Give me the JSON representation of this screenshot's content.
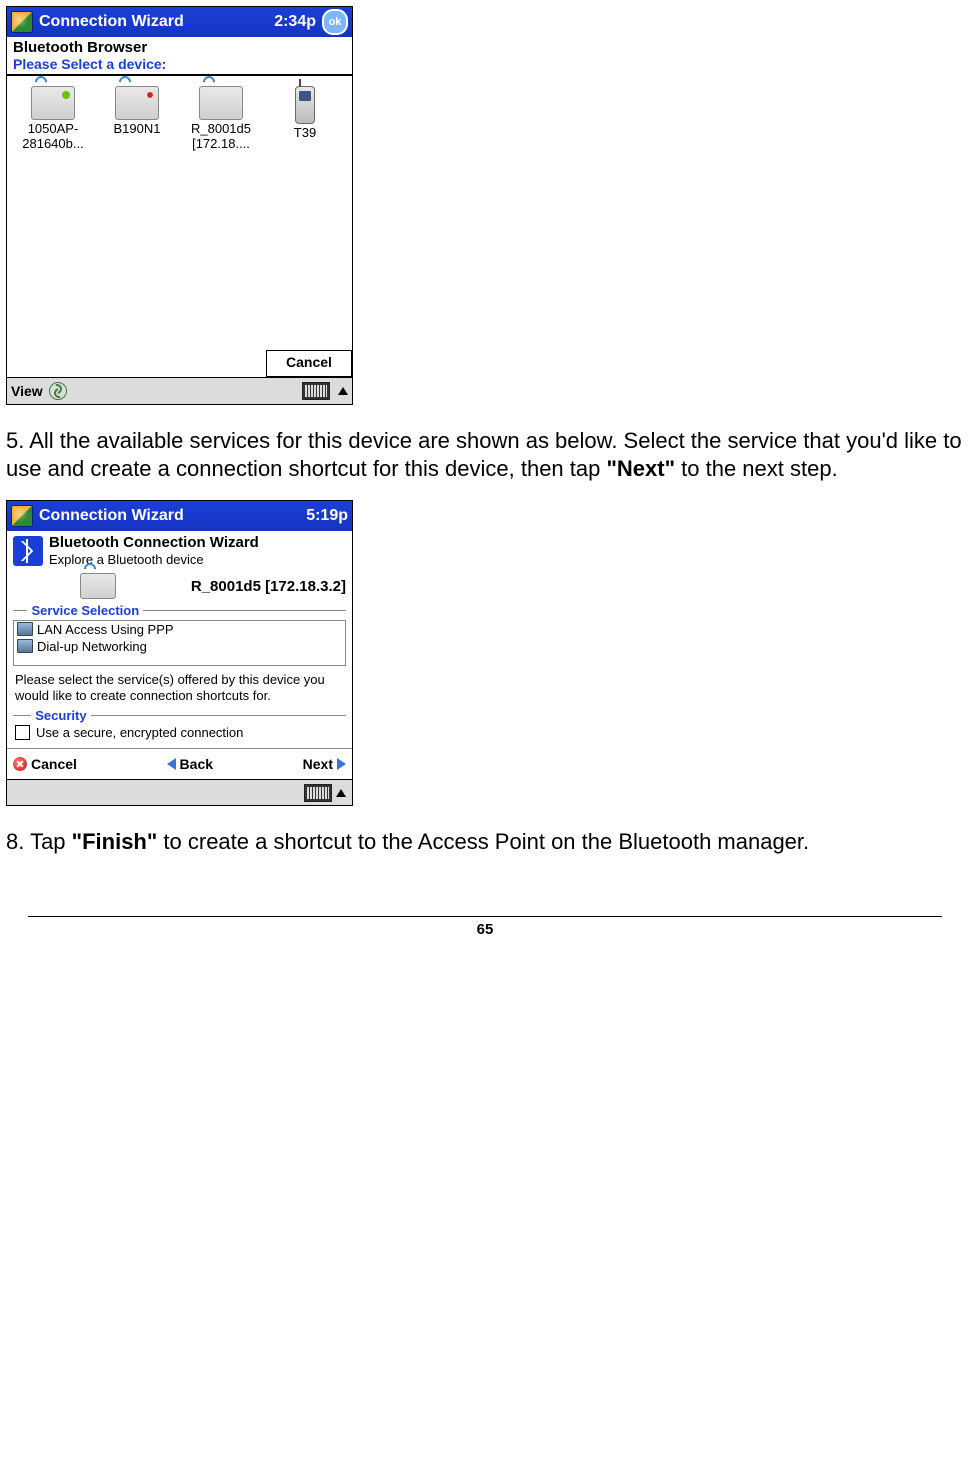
{
  "screenshot1": {
    "title": "Connection Wizard",
    "clock": "2:34p",
    "ok": "ok",
    "heading": "Bluetooth Browser",
    "prompt": "Please Select a device:",
    "devices": [
      {
        "name": "1050AP-281640b..."
      },
      {
        "name": "B190N1"
      },
      {
        "name": "R_8001d5 [172.18...."
      },
      {
        "name": "T39"
      }
    ],
    "cancel": "Cancel",
    "menu_view": "View"
  },
  "step5_pre": "5. All the available services for this device are shown as below. Select the service that you'd like to use and create a connection shortcut for this device, then tap ",
  "step5_bold": "\"Next\"",
  "step5_post": " to the next step.",
  "screenshot2": {
    "title": "Connection Wizard",
    "clock": "5:19p",
    "wiz_title": "Bluetooth Connection Wizard",
    "wiz_sub": "Explore a Bluetooth device",
    "device_name": "R_8001d5 [172.18.3.2]",
    "svc_label": "Service Selection",
    "services": [
      "LAN Access Using PPP",
      "Dial-up Networking"
    ],
    "help": "Please select the service(s) offered by this device you would like to create connection shortcuts for.",
    "sec_label": "Security",
    "sec_check": "Use a secure, encrypted connection",
    "nav_cancel": "Cancel",
    "nav_back": "Back",
    "nav_next": "Next"
  },
  "step8_pre": "8. Tap ",
  "step8_bold": "\"Finish\"",
  "step8_post": " to create a shortcut to the Access Point on the Bluetooth manager.",
  "page_number": "65"
}
